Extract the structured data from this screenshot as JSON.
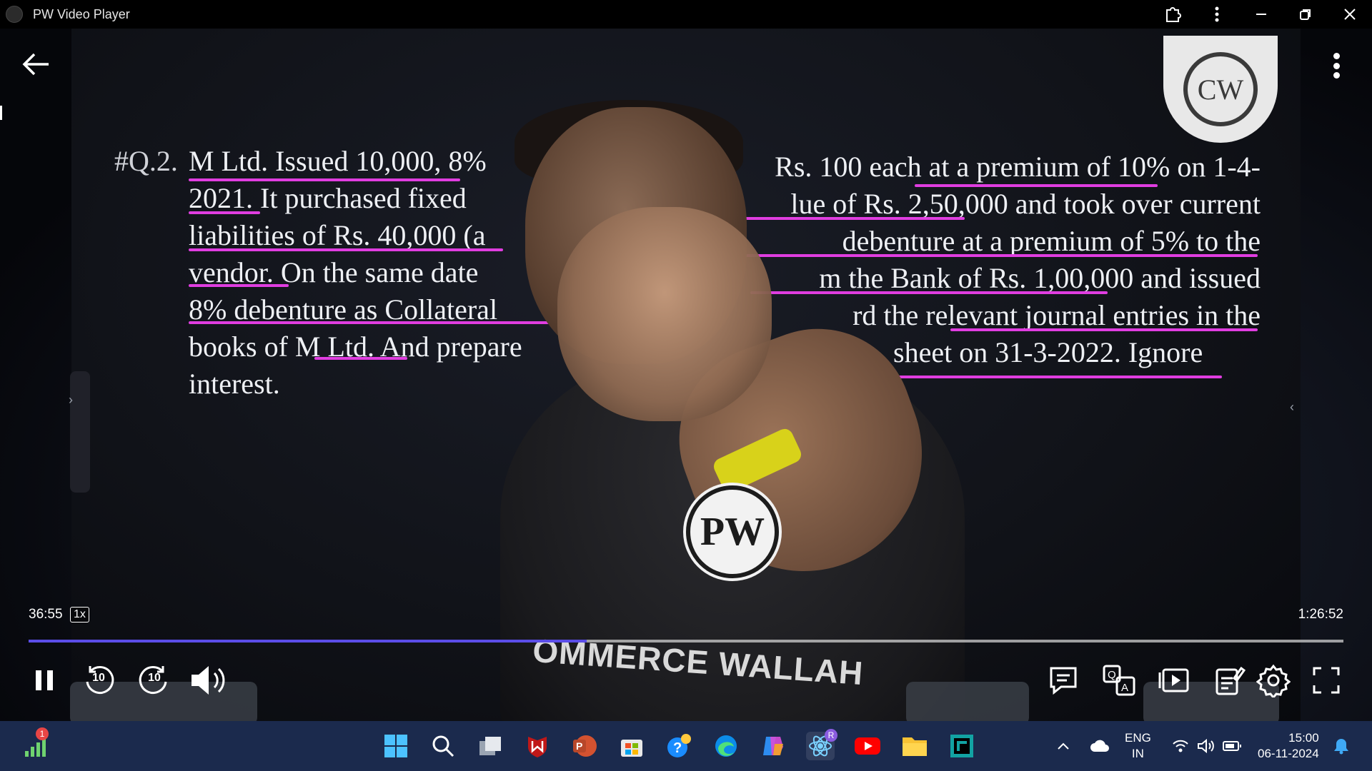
{
  "window": {
    "title": "PW Video Player"
  },
  "question": {
    "number": "#Q.2.",
    "lines": [
      "M Ltd. Issued 10,000, 8%",
      "2021. It purchased fixed",
      "liabilities of Rs. 40,000 (a",
      "vendor. On the same date",
      "8% debenture as Collateral",
      "books of M Ltd. And prepare",
      "interest."
    ],
    "right_lines": [
      "Rs. 100 each at a premium of 10% on 1-4-",
      "lue of Rs. 2,50,000 and took over current",
      "debenture at a premium of 5% to the",
      "m the Bank of Rs. 1,00,000 and issued",
      "rd the relevant journal entries in the",
      "sheet on 31-3-2022. Ignore"
    ],
    "highlight_color": "#e03de0"
  },
  "video": {
    "shirt_text": "OMMERCE WALLAH",
    "shirt_logo": "PW",
    "channel_logo": "CW"
  },
  "player": {
    "current_time": "36:55",
    "speed": "1x",
    "total_time": "1:26:52",
    "progress_fraction": 0.4245,
    "accent_color": "#5b4de8",
    "rewind_label": "10",
    "forward_label": "10"
  },
  "taskbar": {
    "notification_count": "1",
    "copilot_badge": "R",
    "language": "ENG",
    "region": "IN",
    "time": "15:00",
    "date": "06-11-2024"
  }
}
